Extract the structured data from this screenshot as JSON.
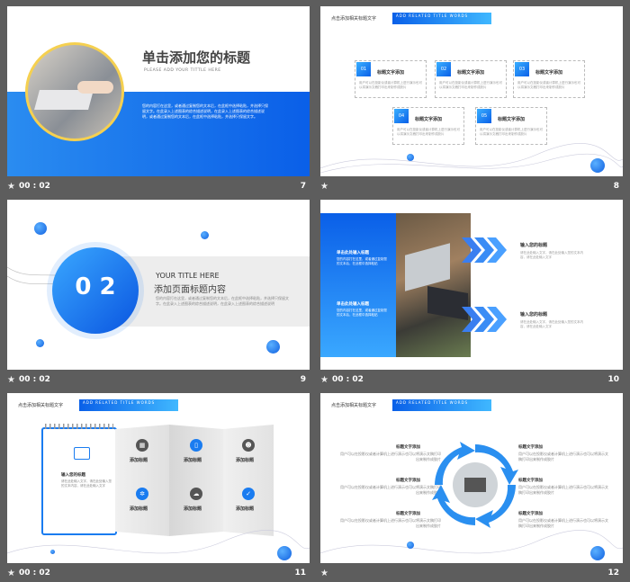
{
  "footer": {
    "time": "00 : 02",
    "star": "★"
  },
  "slide7": {
    "num": "7",
    "title": "单击添加您的标题",
    "subtitle": "PLEASE ADD YOUR TITTLE HERE",
    "body": "您的内容打在这里，或者通过复制您的文本后，在此框中选择粘贴，并选择只保留文字。在此录入上述图表的综合描述说明，在此录入上述图表的综合描述说明，或者通过复制您的文本后，在此框中选择粘贴，并选择只保留文字。"
  },
  "slide8": {
    "num": "8",
    "header": "点击添加相关标题文字",
    "header_en": "ADD RELATED TITLE WORDS",
    "items": [
      {
        "n": "01",
        "title": "标题文字添加",
        "text": "用户可以在投影仪或者计算机上进行演示也可以将演示文稿打印出来制作成胶片"
      },
      {
        "n": "02",
        "title": "标题文字添加",
        "text": "用户可以在投影仪或者计算机上进行演示也可以将演示文稿打印出来制作成胶片"
      },
      {
        "n": "03",
        "title": "标题文字添加",
        "text": "用户可以在投影仪或者计算机上进行演示也可以将演示文稿打印出来制作成胶片"
      },
      {
        "n": "04",
        "title": "标题文字添加",
        "text": "用户可以在投影仪或者计算机上进行演示也可以将演示文稿打印出来制作成胶片"
      },
      {
        "n": "05",
        "title": "标题文字添加",
        "text": "用户可以在投影仪或者计算机上进行演示也可以将演示文稿打印出来制作成胶片"
      }
    ]
  },
  "slide9": {
    "num": "9",
    "big": "0 2",
    "en": "YOUR TITLE  HERE",
    "title": "添加页面标题内容",
    "body": "您的内容打在这里，或者通过复制您的文本后，在此框中选择粘贴，并选择只保留文字。在此录入上述图表的综合描述说明，在此录入上述图表的综合描述说明"
  },
  "slide10": {
    "num": "10",
    "left1_title": "单击此处输入标题",
    "left1_text": "您的内容打在这里，或者通过复制您的文本后，在此框中选择粘贴",
    "left2_title": "单击此处输入标题",
    "left2_text": "您的内容打在这里，或者通过复制您的文本后，在此框中选择粘贴",
    "right1_title": "输入您的标题",
    "right1_text": "请在此处输入文字，请在此处输入您的文本内容，请在此处输入文字",
    "right2_title": "输入您的标题",
    "right2_text": "请在此处输入文字，请在此处输入您的文本内容，请在此处输入文字"
  },
  "slide11": {
    "num": "11",
    "header": "点击添加相关标题文字",
    "header_en": "ADD RELATED TITLE WORDS",
    "card_title": "输入您的标题",
    "card_text": "请在此处输入文字，请在此处输入您的文本内容，请在此处输入文字",
    "items": [
      "添加标题",
      "添加标题",
      "添加标题",
      "添加标题",
      "添加标题",
      "添加标题"
    ]
  },
  "slide12": {
    "num": "12",
    "header": "点击添加相关标题文字",
    "header_en": "ADD RELATED TITLE WORDS",
    "left": [
      {
        "title": "标题文字添加",
        "text": "用户可以在投影仪或者计算机上进行演示也可以将演示文稿打印出来制作成胶片"
      },
      {
        "title": "标题文字添加",
        "text": "用户可以在投影仪或者计算机上进行演示也可以将演示文稿打印出来制作成胶片"
      },
      {
        "title": "标题文字添加",
        "text": "用户可以在投影仪或者计算机上进行演示也可以将演示文稿打印出来制作成胶片"
      }
    ],
    "right": [
      {
        "title": "标题文字添加",
        "text": "用户可以在投影仪或者计算机上进行演示也可以将演示文稿打印出来制作成胶片"
      },
      {
        "title": "标题文字添加",
        "text": "用户可以在投影仪或者计算机上进行演示也可以将演示文稿打印出来制作成胶片"
      },
      {
        "title": "标题文字添加",
        "text": "用户可以在投影仪或者计算机上进行演示也可以将演示文稿打印出来制作成胶片"
      }
    ]
  }
}
